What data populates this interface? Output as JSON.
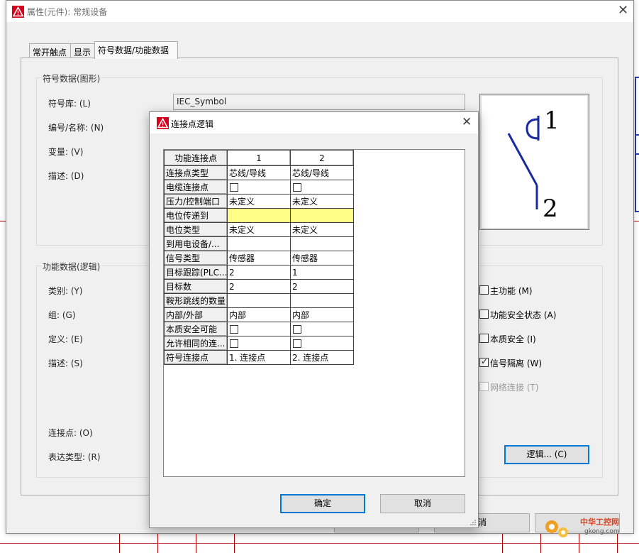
{
  "main_window": {
    "title": "属性(元件): 常规设备",
    "tabs": [
      "常开触点",
      "显示",
      "符号数据/功能数据"
    ],
    "symbol_group": {
      "title": "符号数据(图形)",
      "labels": [
        "符号库: (L)",
        "编号/名称: (N)",
        "变量: (V)",
        "描述: (D)"
      ],
      "library_value": "IEC_Symbol"
    },
    "function_group": {
      "title": "功能数据(逻辑)",
      "labels": [
        "类别: (Y)",
        "组: (G)",
        "定义: (E)",
        "描述: (S)",
        "连接点: (O)",
        "表达类型: (R)"
      ],
      "checkboxes": [
        {
          "label": "主功能 (M)",
          "checked": false,
          "enabled": true
        },
        {
          "label": "功能安全状态 (A)",
          "checked": false,
          "enabled": true
        },
        {
          "label": "本质安全 (I)",
          "checked": false,
          "enabled": true
        },
        {
          "label": "信号隔离 (W)",
          "checked": true,
          "enabled": true
        },
        {
          "label": "网络连接 (T)",
          "checked": false,
          "enabled": false
        }
      ],
      "logic_button": "逻辑... (C)"
    },
    "cancel_partial": "消",
    "preview_labels": [
      "1",
      "2"
    ]
  },
  "dialog": {
    "title": "连接点逻辑",
    "column_header": "功能连接点",
    "columns": [
      "1",
      "2"
    ],
    "rows": [
      {
        "label": "连接点类型",
        "values": [
          "芯线/导线",
          "芯线/导线"
        ],
        "kind": "text"
      },
      {
        "label": "电缆连接点",
        "values": [
          "",
          ""
        ],
        "kind": "checkbox"
      },
      {
        "label": "压力/控制端口",
        "values": [
          "未定义",
          "未定义"
        ],
        "kind": "text"
      },
      {
        "label": "电位传递到",
        "values": [
          "",
          ""
        ],
        "kind": "highlight"
      },
      {
        "label": "电位类型",
        "values": [
          "未定义",
          "未定义"
        ],
        "kind": "text"
      },
      {
        "label": "到用电设备/...",
        "values": [
          "",
          ""
        ],
        "kind": "text"
      },
      {
        "label": "信号类型",
        "values": [
          "传感器",
          "传感器"
        ],
        "kind": "text"
      },
      {
        "label": "目标跟踪(PLC...",
        "values": [
          "2",
          "1"
        ],
        "kind": "text"
      },
      {
        "label": "目标数",
        "values": [
          "2",
          "2"
        ],
        "kind": "text"
      },
      {
        "label": "鞍形跳线的数量",
        "values": [
          "",
          ""
        ],
        "kind": "text"
      },
      {
        "label": "内部/外部",
        "values": [
          "内部",
          "内部"
        ],
        "kind": "text"
      },
      {
        "label": "本质安全可能",
        "values": [
          "",
          ""
        ],
        "kind": "checkbox"
      },
      {
        "label": "允许相同的连...",
        "values": [
          "",
          ""
        ],
        "kind": "checkbox"
      },
      {
        "label": "符号连接点",
        "values": [
          "1. 连接点",
          "2. 连接点"
        ],
        "kind": "text"
      }
    ],
    "ok_label": "确定",
    "cancel_label": "取消"
  },
  "watermark": {
    "text": "中华工控网",
    "url": "gkong.com"
  },
  "colors": {
    "accent": "#0078d7",
    "highlight": "#ffff88",
    "cad_red": "#b00000",
    "cad_blue": "#2a3aa8"
  }
}
